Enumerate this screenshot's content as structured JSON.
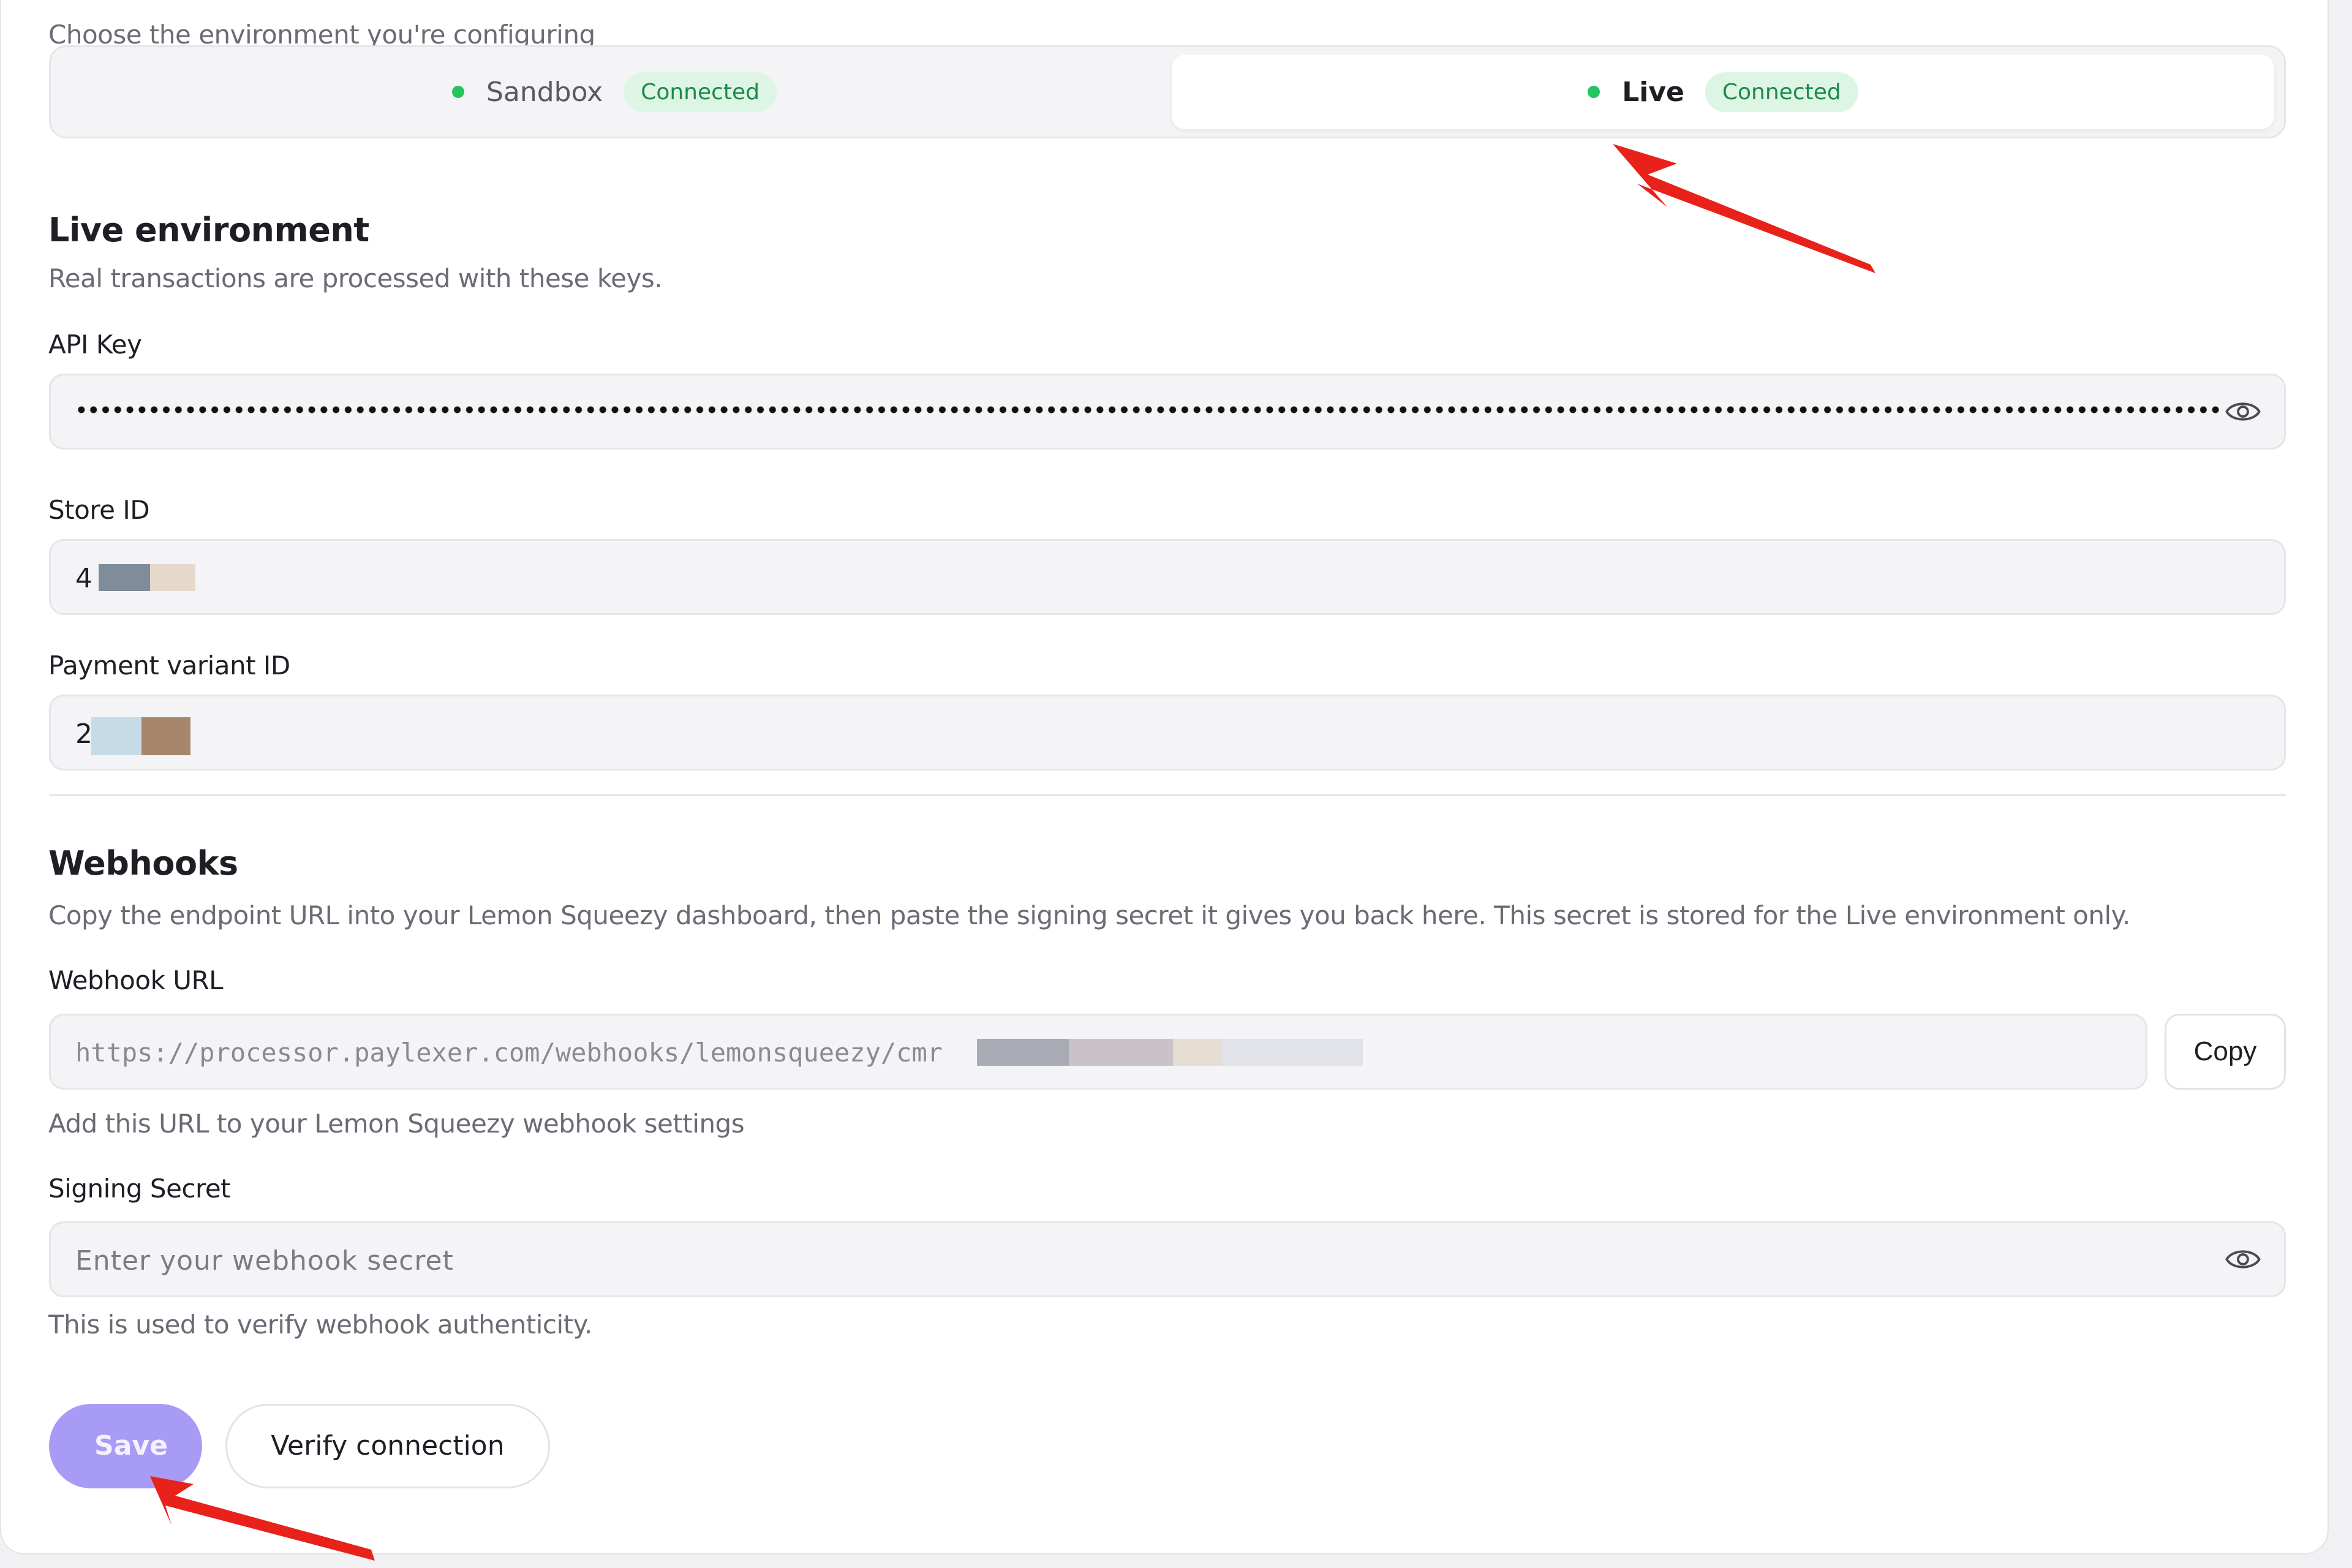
{
  "env_prompt": "Choose the environment you're configuring",
  "environments": [
    {
      "name": "Sandbox",
      "status": "Connected"
    },
    {
      "name": "Live",
      "status": "Connected"
    }
  ],
  "selected_environment": "Live",
  "live": {
    "title": "Live environment",
    "subtitle": "Real transactions are processed with these keys.",
    "api_key_label": "API Key",
    "store_id_label": "Store ID",
    "store_id_value": "4",
    "payment_variant_label": "Payment variant ID",
    "payment_variant_value": "2"
  },
  "webhooks": {
    "title": "Webhooks",
    "description": "Copy the endpoint URL into your Lemon Squeezy dashboard, then paste the signing secret it gives you back here. This secret is stored for the Live environment only.",
    "url_label": "Webhook URL",
    "url_value": "https://processor.paylexer.com/webhooks/lemonsqueezy/cmr",
    "copy_label": "Copy",
    "url_hint": "Add this URL to your Lemon Squeezy webhook settings",
    "secret_label": "Signing Secret",
    "secret_placeholder": "Enter your webhook secret",
    "secret_hint": "This is used to verify webhook authenticity."
  },
  "actions": {
    "save_label": "Save",
    "verify_label": "Verify connection"
  },
  "colors": {
    "accent": "#a89bf6",
    "connected_badge_bg": "#dcf5e5",
    "connected_badge_text": "#1e8a4a",
    "status_dot": "#22c55e",
    "annotation_arrow": "#e8211b"
  },
  "icons": {
    "api_key_toggle": "eye-icon",
    "secret_toggle": "eye-icon"
  }
}
